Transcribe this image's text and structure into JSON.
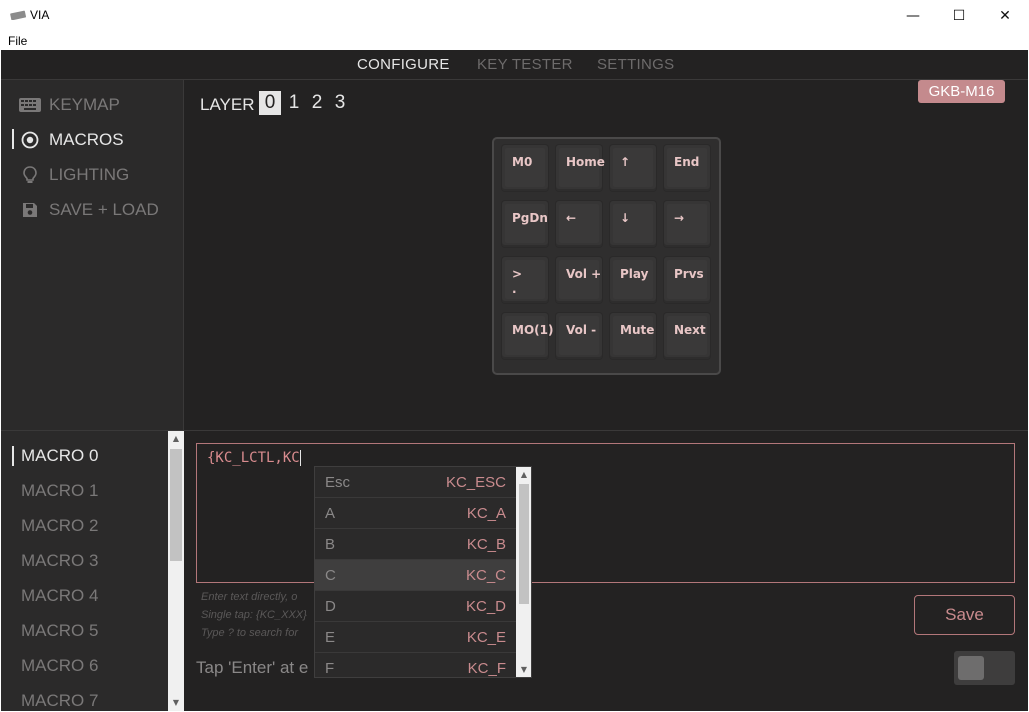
{
  "window": {
    "title": "VIA",
    "controls": {
      "minimize": "—",
      "maximize": "☐",
      "close": "✕"
    }
  },
  "menu": {
    "file": "File"
  },
  "nav": {
    "tabs": [
      {
        "label": "CONFIGURE",
        "active": true
      },
      {
        "label": "KEY TESTER",
        "active": false
      },
      {
        "label": "SETTINGS",
        "active": false
      }
    ]
  },
  "sidebar": {
    "items": [
      {
        "label": "KEYMAP",
        "icon": "keyboard-icon",
        "active": false
      },
      {
        "label": "MACROS",
        "icon": "record-icon",
        "active": true
      },
      {
        "label": "LIGHTING",
        "icon": "lightbulb-icon",
        "active": false
      },
      {
        "label": "SAVE + LOAD",
        "icon": "floppy-disk-icon",
        "active": false
      }
    ]
  },
  "layers": {
    "label": "LAYER",
    "items": [
      "0",
      "1",
      "2",
      "3"
    ],
    "selected": "0"
  },
  "device": {
    "name": "GKB-M16"
  },
  "keymap": {
    "rows": [
      [
        "M0",
        "Home",
        "↑",
        "End"
      ],
      [
        "PgDn",
        "←",
        "↓",
        "→"
      ],
      [
        ">\n.",
        "Vol +",
        "Play",
        "Prvs"
      ],
      [
        "MO(1)",
        "Vol -",
        "Mute",
        "Next"
      ]
    ]
  },
  "macros": {
    "items": [
      "MACRO 0",
      "MACRO 1",
      "MACRO 2",
      "MACRO 3",
      "MACRO 4",
      "MACRO 5",
      "MACRO 6",
      "MACRO 7"
    ],
    "selected": "MACRO 0"
  },
  "editor": {
    "value": "{KC_LCTL,KC",
    "hints": [
      "Enter text directly, o",
      "Single tap: {KC_XXX}",
      "Type ? to search for"
    ],
    "tap_hint": "Tap 'Enter' at e",
    "save_label": "Save"
  },
  "autocomplete": {
    "items": [
      {
        "key": "Esc",
        "code": "KC_ESC"
      },
      {
        "key": "A",
        "code": "KC_A"
      },
      {
        "key": "B",
        "code": "KC_B"
      },
      {
        "key": "C",
        "code": "KC_C"
      },
      {
        "key": "D",
        "code": "KC_D"
      },
      {
        "key": "E",
        "code": "KC_E"
      },
      {
        "key": "F",
        "code": "KC_F"
      }
    ],
    "highlighted": "C"
  },
  "colors": {
    "accent": "#c48a8d",
    "background": "#232222",
    "sidebar": "#2b2a2a",
    "key_legend": "#e8c6c6"
  }
}
